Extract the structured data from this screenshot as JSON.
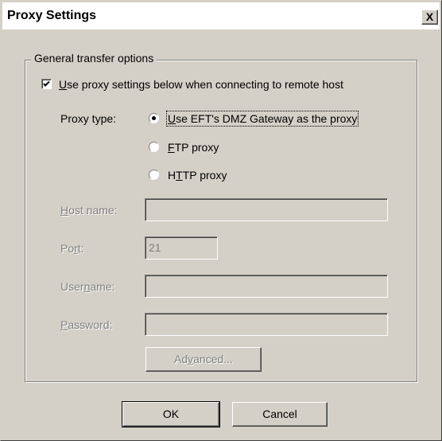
{
  "window": {
    "title": "Proxy Settings",
    "close_glyph": "X"
  },
  "group": {
    "legend": "General transfer options"
  },
  "use_proxy": {
    "pre": "",
    "mnemonic": "U",
    "post": "se proxy settings below when connecting to remote host",
    "checked": true
  },
  "proxy_type": {
    "label": "Proxy type:",
    "options": [
      {
        "pre": "",
        "mnemonic": "U",
        "post": "se EFT's DMZ Gateway as the proxy",
        "selected": true
      },
      {
        "pre": "",
        "mnemonic": "F",
        "post": "TP proxy",
        "selected": false
      },
      {
        "pre": "H",
        "mnemonic": "T",
        "post": "TP proxy",
        "selected": false
      }
    ]
  },
  "fields": {
    "host": {
      "pre": "",
      "mnemonic": "H",
      "post": "ost name:",
      "value": ""
    },
    "port": {
      "pre": "Po",
      "mnemonic": "r",
      "post": "t:",
      "value": "21"
    },
    "username": {
      "pre": "User",
      "mnemonic": "n",
      "post": "ame:",
      "value": ""
    },
    "password": {
      "pre": "",
      "mnemonic": "P",
      "post": "assword:",
      "value": ""
    }
  },
  "buttons": {
    "advanced": {
      "pre": "Ad",
      "mnemonic": "v",
      "post": "anced..."
    },
    "ok": "OK",
    "cancel": "Cancel"
  },
  "colors": {
    "face": "#d4d0c8",
    "shadow": "#808080",
    "highlight": "#ffffff",
    "disabled_text": "#808080"
  }
}
